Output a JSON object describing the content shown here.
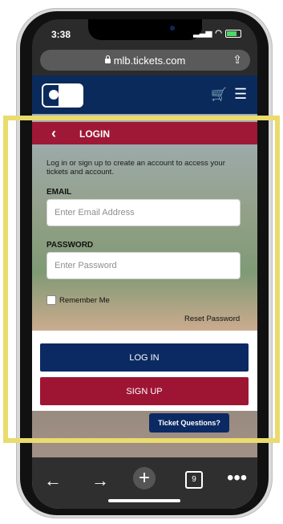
{
  "status_bar": {
    "time": "3:38"
  },
  "browser": {
    "url": "mlb.tickets.com",
    "tab_count": "9"
  },
  "header": {
    "icons": [
      "mlb-logo-icon",
      "cart-icon",
      "menu-icon"
    ]
  },
  "login": {
    "title": "LOGIN",
    "intro": "Log in or sign up to create an account to access your tickets and account.",
    "email_label": "EMAIL",
    "email_placeholder": "Enter Email Address",
    "password_label": "PASSWORD",
    "password_placeholder": "Enter Password",
    "remember_label": "Remember Me",
    "reset_label": "Reset Password",
    "login_button": "LOG IN",
    "signup_button": "SIGN UP"
  },
  "help": {
    "label": "Ticket Questions?"
  },
  "colors": {
    "header_blue": "#0a2a5c",
    "login_bar_red": "#9f1835",
    "signup_red": "#9e1534",
    "highlight_yellow": "#eadb6d"
  }
}
